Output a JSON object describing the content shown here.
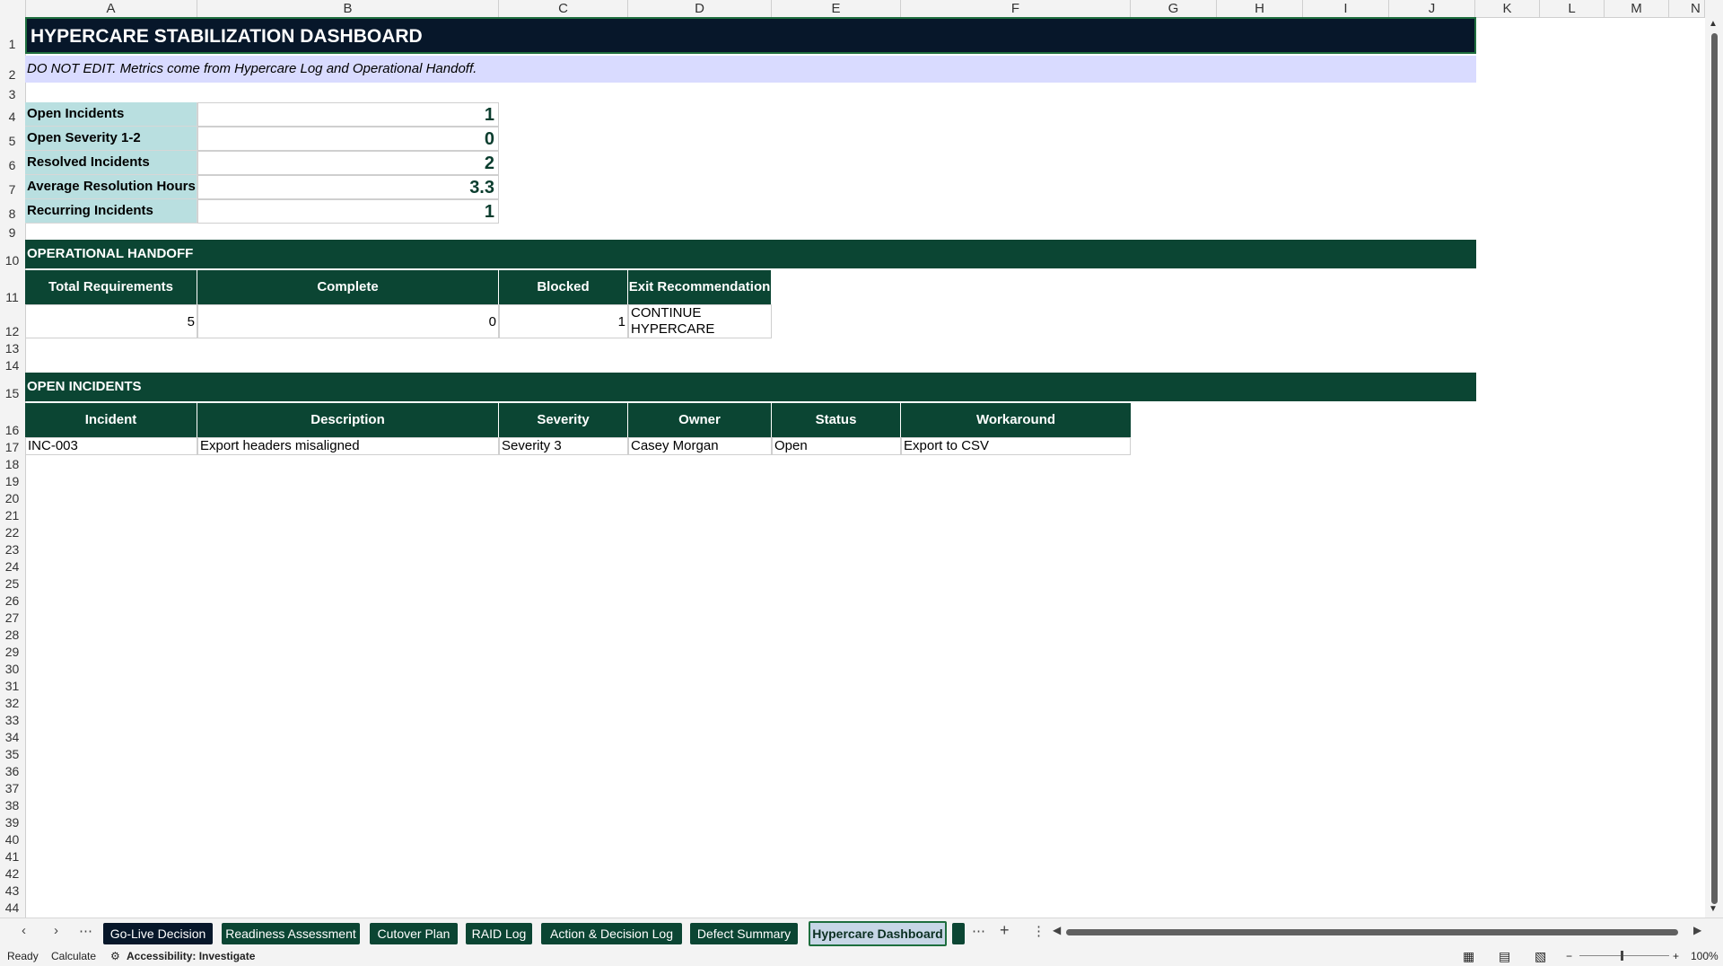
{
  "columns": [
    "A",
    "B",
    "C",
    "D",
    "E",
    "F",
    "G",
    "H",
    "I",
    "J",
    "K",
    "L",
    "M",
    "N"
  ],
  "rows": [
    "1",
    "2",
    "3",
    "4",
    "5",
    "6",
    "7",
    "8",
    "9",
    "10",
    "11",
    "12",
    "13",
    "14",
    "15",
    "16",
    "17",
    "18",
    "19",
    "20",
    "21",
    "22",
    "23",
    "24",
    "25",
    "26",
    "27",
    "28",
    "29",
    "30",
    "31",
    "32",
    "33",
    "34",
    "35",
    "36",
    "37",
    "38",
    "39",
    "40",
    "41",
    "42",
    "43",
    "44"
  ],
  "title": "HYPERCARE STABILIZATION DASHBOARD",
  "note": "DO NOT EDIT. Metrics come from Hypercare Log and Operational Handoff.",
  "kpis": [
    {
      "label": "Open Incidents",
      "value": "1"
    },
    {
      "label": "Open Severity 1-2",
      "value": "0"
    },
    {
      "label": "Resolved Incidents",
      "value": "2"
    },
    {
      "label": "Average Resolution Hours",
      "value": "3.3"
    },
    {
      "label": "Recurring Incidents",
      "value": "1"
    }
  ],
  "handoff": {
    "section": "OPERATIONAL HANDOFF",
    "headers": [
      "Total Requirements",
      "Complete",
      "Blocked",
      "Exit Recommendation"
    ],
    "values": [
      "5",
      "0",
      "1"
    ],
    "recommendation_line1": "CONTINUE",
    "recommendation_line2": "HYPERCARE"
  },
  "incidents": {
    "section": "OPEN INCIDENTS",
    "headers": [
      "Incident",
      "Description",
      "Severity",
      "Owner",
      "Status",
      "Workaround"
    ],
    "rows": [
      [
        "INC-003",
        "Export headers misaligned",
        "Severity 3",
        "Casey Morgan",
        "Open",
        "Export to CSV"
      ]
    ]
  },
  "tabs": {
    "more": "⋯",
    "sheets": [
      "Go-Live Decision",
      "Readiness Assessment",
      "Cutover Plan",
      "RAID Log",
      "Action & Decision Log",
      "Defect Summary",
      "Hypercare Dashboard"
    ],
    "active": "Hypercare Dashboard",
    "add": "+"
  },
  "status": {
    "ready": "Ready",
    "calculate": "Calculate",
    "accessibility": "Accessibility: Investigate",
    "zoom": "100%"
  }
}
